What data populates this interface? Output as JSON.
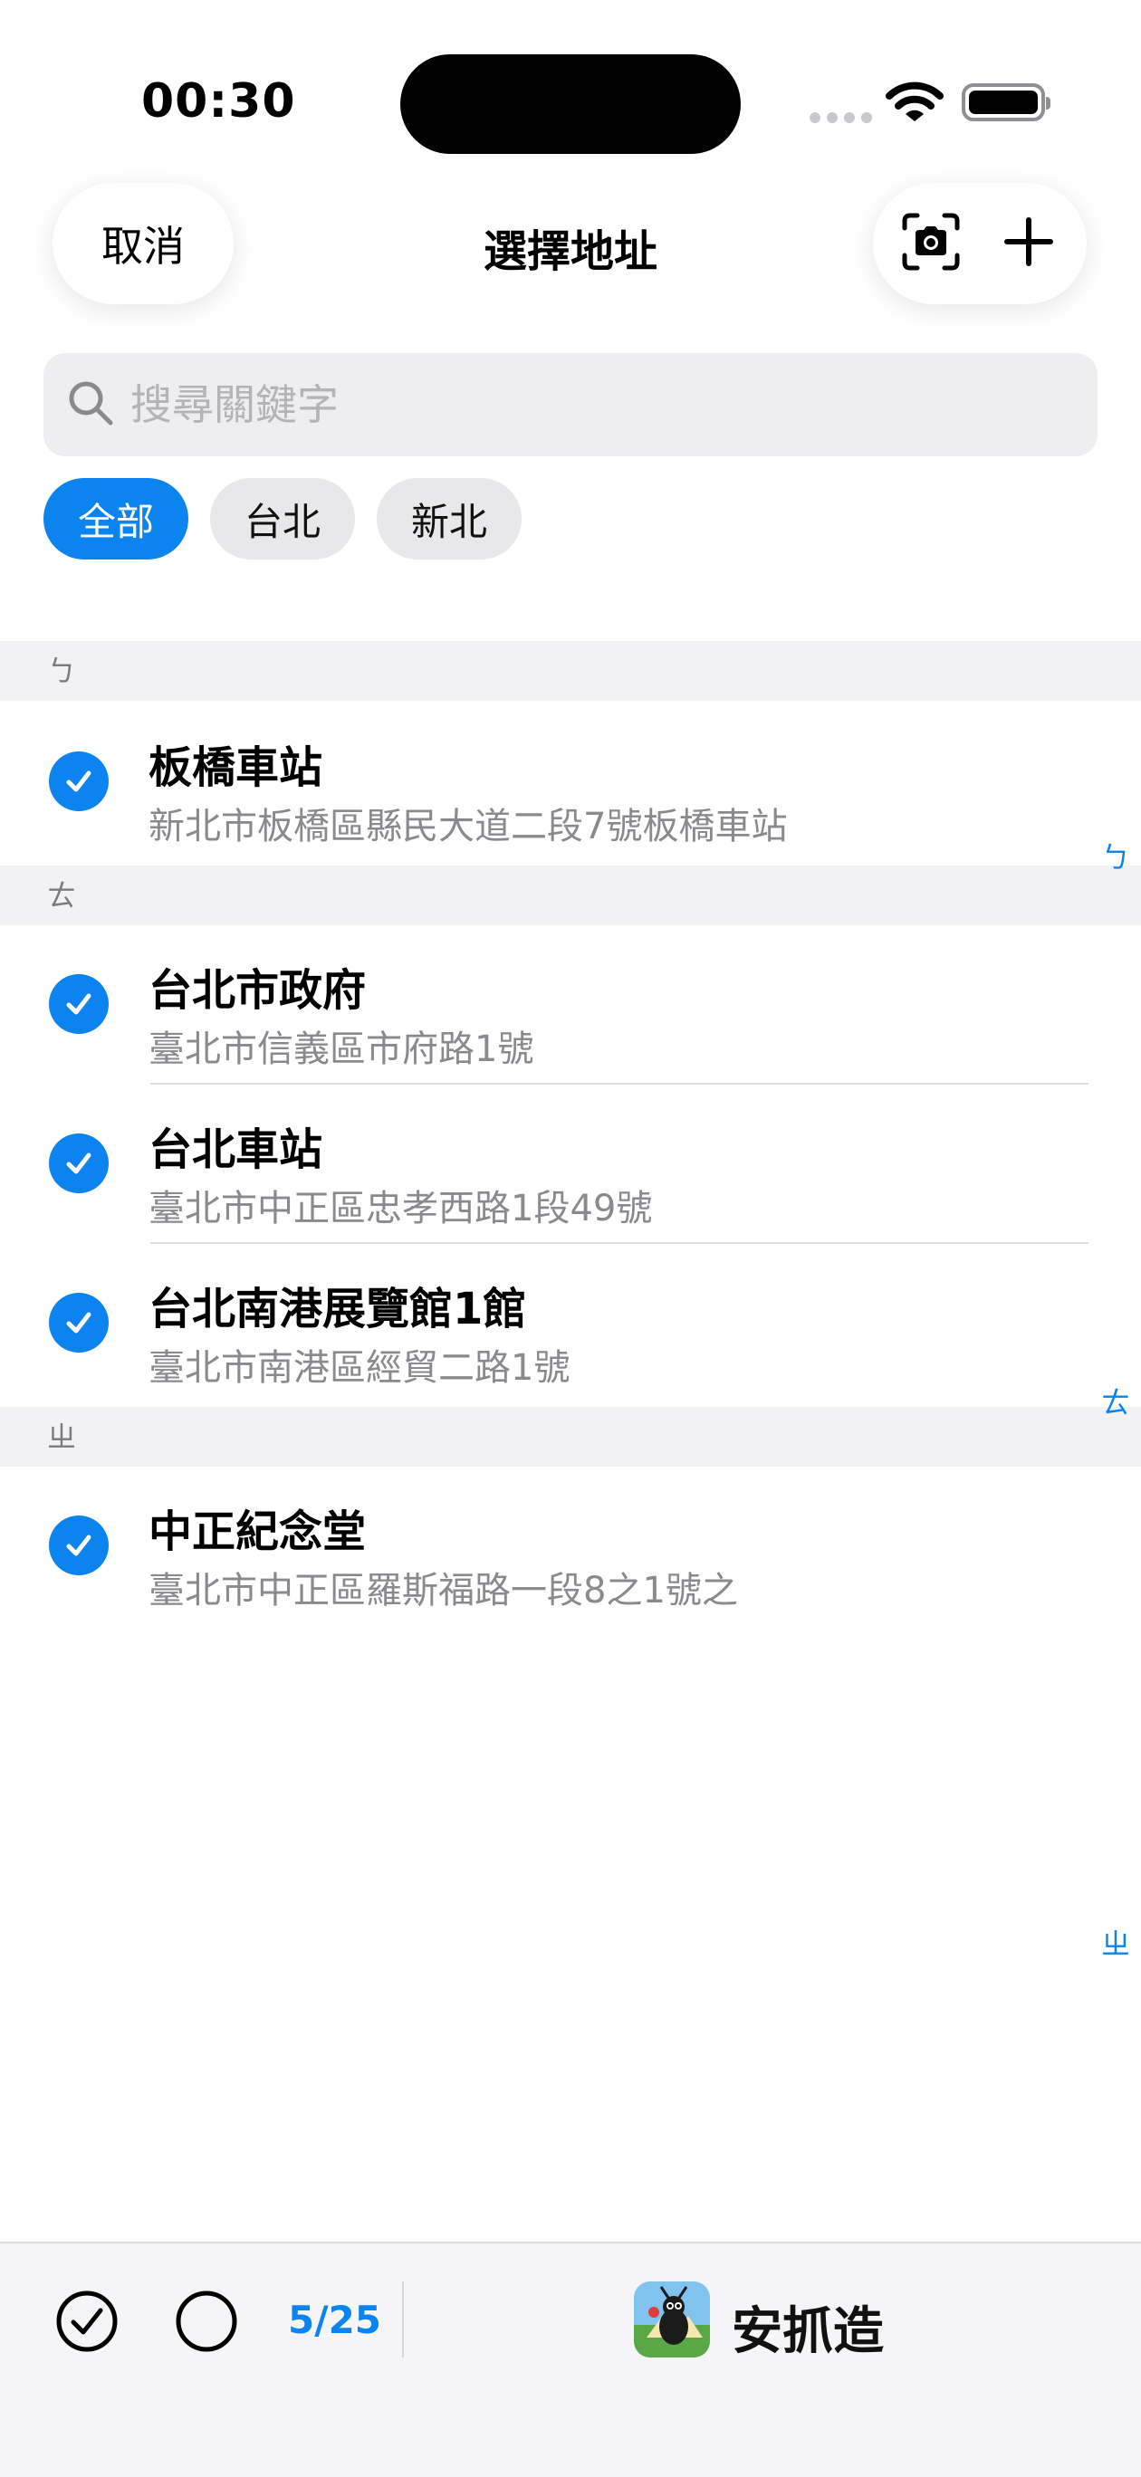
{
  "status_bar": {
    "time": "00:30"
  },
  "nav": {
    "cancel_label": "取消",
    "title": "選擇地址"
  },
  "search": {
    "placeholder": "搜尋關鍵字"
  },
  "filters": [
    {
      "label": "全部",
      "active": true
    },
    {
      "label": "台北",
      "active": false
    },
    {
      "label": "新北",
      "active": false
    }
  ],
  "sections": [
    {
      "header": "ㄅ",
      "rows": [
        {
          "name": "板橋車站",
          "address": "新北市板橋區縣民大道二段7號板橋車站",
          "checked": true
        }
      ]
    },
    {
      "header": "ㄊ",
      "rows": [
        {
          "name": "台北市政府",
          "address": "臺北市信義區市府路1號",
          "checked": true
        },
        {
          "name": "台北車站",
          "address": "臺北市中正區忠孝西路1段49號",
          "checked": true
        },
        {
          "name": "台北南港展覽館1館",
          "address": "臺北市南港區經貿二路1號",
          "checked": true
        }
      ]
    },
    {
      "header": "ㄓ",
      "rows": [
        {
          "name": "中正紀念堂",
          "address": "臺北市中正區羅斯福路一段8之1號之",
          "checked": true
        }
      ]
    }
  ],
  "section_index": [
    "ㄅ",
    "ㄊ",
    "ㄓ"
  ],
  "bottom_bar": {
    "count": "5/25",
    "brand_name": "安抓造"
  },
  "colors": {
    "accent": "#0b84f0",
    "section_bg": "#f2f2f5",
    "chip_bg": "#e8e8ea"
  },
  "icons": {
    "camera": "camera-scan-icon",
    "add": "plus-icon",
    "search": "search-icon",
    "check": "checkmark-circle-icon",
    "empty": "empty-circle-icon"
  }
}
